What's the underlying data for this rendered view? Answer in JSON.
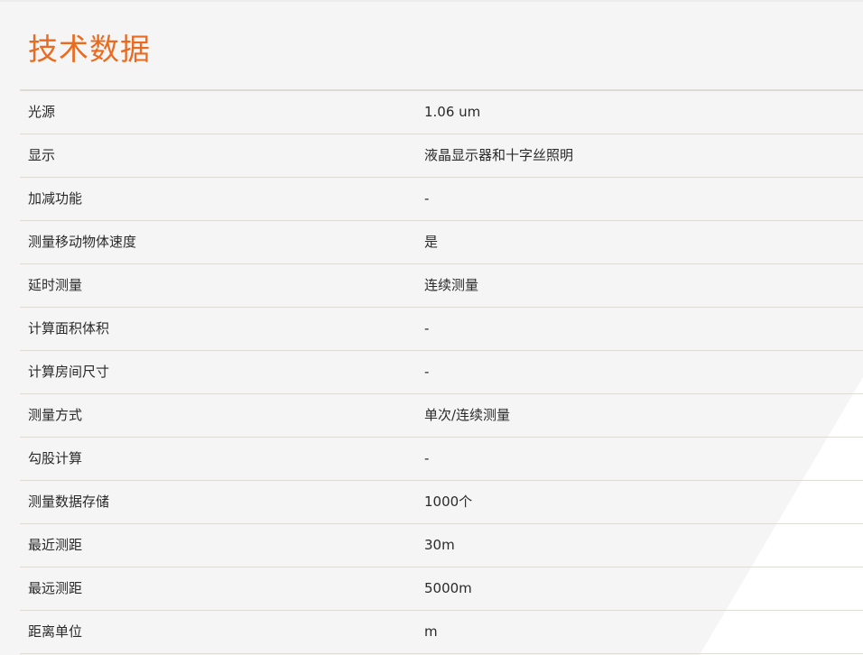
{
  "section": {
    "title": "技术数据"
  },
  "specs": [
    {
      "label": "光源",
      "value": "1.06 um"
    },
    {
      "label": "显示",
      "value": "液晶显示器和十字丝照明"
    },
    {
      "label": "加减功能",
      "value": "-"
    },
    {
      "label": "测量移动物体速度",
      "value": "是"
    },
    {
      "label": "延时测量",
      "value": "连续测量"
    },
    {
      "label": "计算面积体积",
      "value": "-"
    },
    {
      "label": "计算房间尺寸",
      "value": "-"
    },
    {
      "label": "测量方式",
      "value": "单次/连续测量"
    },
    {
      "label": "勾股计算",
      "value": "-"
    },
    {
      "label": "测量数据存储",
      "value": "1000个"
    },
    {
      "label": "最近测距",
      "value": "30m"
    },
    {
      "label": "最远测距",
      "value": "5000m"
    },
    {
      "label": "距离单位",
      "value": "m"
    }
  ],
  "colors": {
    "title": "#ea6b1f",
    "background": "#f5f5f5",
    "row_divider": "#dedcd4"
  }
}
